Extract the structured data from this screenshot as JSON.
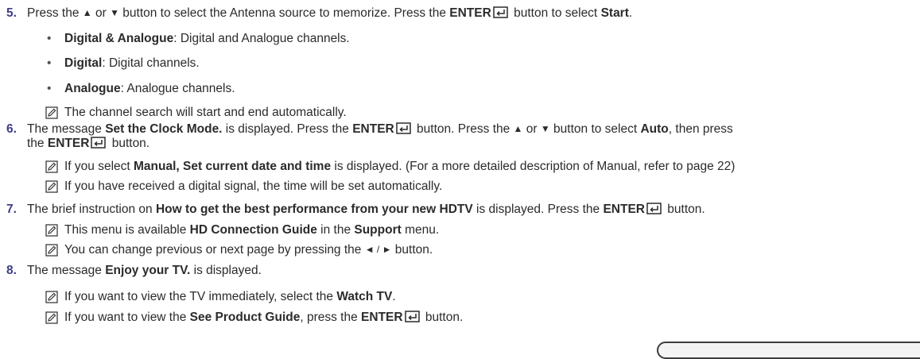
{
  "steps": [
    {
      "num": "5.",
      "line1": [
        "Press the ",
        "▲",
        " or ",
        "▼",
        " button to select the Antenna source to memorize. Press the ",
        "ENTER",
        " button to select ",
        "Start",
        "."
      ],
      "bullets": [
        {
          "bold": "Digital & Analogue",
          "text": ": Digital and Analogue channels."
        },
        {
          "bold": "Digital",
          "text": ": Digital channels."
        },
        {
          "bold": "Analogue",
          "text": ": Analogue channels."
        }
      ],
      "notes": [
        [
          "The channel search will start and end automatically."
        ]
      ]
    },
    {
      "num": "6.",
      "line1": [
        "The message ",
        "Set the Clock Mode.",
        " is displayed. Press the ",
        "ENTER",
        " button. Press the ",
        "▲",
        " or ",
        "▼",
        " button to select ",
        "Auto",
        ", then press"
      ],
      "line2": [
        "the ",
        "ENTER",
        " button."
      ],
      "notes": [
        [
          "If you select ",
          "Manual, Set current date and time",
          " is displayed. (For a more detailed description of Manual, refer to page 22)"
        ],
        [
          "If you have received a digital signal, the time will be set automatically."
        ]
      ]
    },
    {
      "num": "7.",
      "line1": [
        "The brief instruction on ",
        "How to get the best performance from your new HDTV",
        " is displayed. Press the ",
        "ENTER",
        " button."
      ],
      "notes": [
        [
          "This menu is available ",
          "HD Connection Guide",
          " in the ",
          "Support",
          " menu."
        ],
        [
          "You can change previous or next page by pressing the ",
          "◄ / ►",
          " button."
        ]
      ]
    },
    {
      "num": "8.",
      "line1": [
        "The message ",
        "Enjoy your TV.",
        " is displayed."
      ],
      "notes": [
        [
          "If you want to view the TV immediately, select the ",
          "Watch TV",
          "."
        ],
        [
          "If you want to view the ",
          "See Product Guide",
          ", press the ",
          "ENTER",
          " button."
        ]
      ]
    }
  ]
}
